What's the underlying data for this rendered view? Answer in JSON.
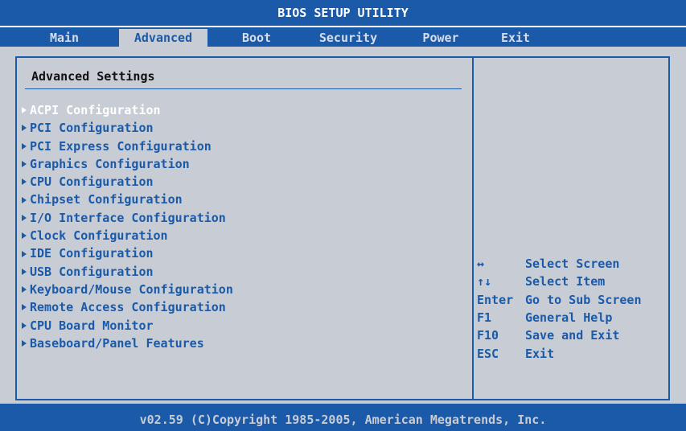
{
  "title": "BIOS SETUP UTILITY",
  "tabs": [
    {
      "label": "Main"
    },
    {
      "label": "Advanced"
    },
    {
      "label": "Boot"
    },
    {
      "label": "Security"
    },
    {
      "label": "Power"
    },
    {
      "label": "Exit"
    }
  ],
  "active_tab": "Advanced",
  "panel": {
    "heading": "Advanced Settings",
    "selected_item": "ACPI Configuration",
    "items": [
      {
        "label": "ACPI Configuration"
      },
      {
        "label": "PCI Configuration"
      },
      {
        "label": "PCI Express Configuration"
      },
      {
        "label": "Graphics Configuration"
      },
      {
        "label": "CPU Configuration"
      },
      {
        "label": "Chipset Configuration"
      },
      {
        "label": "I/O Interface Configuration"
      },
      {
        "label": "Clock Configuration"
      },
      {
        "label": "IDE Configuration"
      },
      {
        "label": "USB Configuration"
      },
      {
        "label": "Keyboard/Mouse Configuration"
      },
      {
        "label": "Remote Access Configuration"
      },
      {
        "label": "CPU Board Monitor"
      },
      {
        "label": "Baseboard/Panel Features"
      }
    ]
  },
  "help": [
    {
      "key": "↔",
      "desc": "Select Screen"
    },
    {
      "key": "↑↓",
      "desc": "Select Item"
    },
    {
      "key": "Enter",
      "desc": "Go to Sub Screen"
    },
    {
      "key": "F1",
      "desc": "General Help"
    },
    {
      "key": "F10",
      "desc": "Save and Exit"
    },
    {
      "key": "ESC",
      "desc": "Exit"
    }
  ],
  "footer": "v02.59 (C)Copyright 1985-2005, American Megatrends, Inc.",
  "colors": {
    "blue": "#1a5aa8",
    "panel_gray": "#c8ccd4",
    "white": "#ffffff"
  }
}
